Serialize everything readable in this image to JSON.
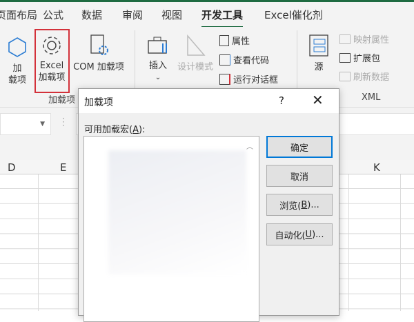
{
  "tabs": [
    "页面布局",
    "公式",
    "数据",
    "审阅",
    "视图",
    "开发工具",
    "Excel催化剂"
  ],
  "active_tab": "开发工具",
  "ribbon": {
    "addins_group": {
      "label": "加载项",
      "addins": "加\n载项",
      "excel_addins_1": "Excel",
      "excel_addins_2": "加载项",
      "com_addins": "COM 加载项"
    },
    "controls_group": {
      "insert": "插入",
      "design_mode": "设计模式",
      "properties": "属性",
      "view_code": "查看代码",
      "run_dialog": "运行对话框"
    },
    "xml_group": {
      "label": "XML",
      "source": "源",
      "map_properties": "映射属性",
      "expansion_packs": "扩展包",
      "refresh_data": "刷新数据"
    }
  },
  "columns": [
    "D",
    "E",
    "K"
  ],
  "dialog": {
    "title": "加载项",
    "help": "?",
    "close": "✕",
    "list_label": "可用加载宏(",
    "list_label_key": "A",
    "list_label_end": "):",
    "buttons": {
      "ok": "确定",
      "cancel": "取消",
      "browse": "浏览(",
      "browse_key": "B",
      "browse_end": ")...",
      "automation": "自动化(",
      "automation_key": "U",
      "automation_end": ")..."
    }
  }
}
